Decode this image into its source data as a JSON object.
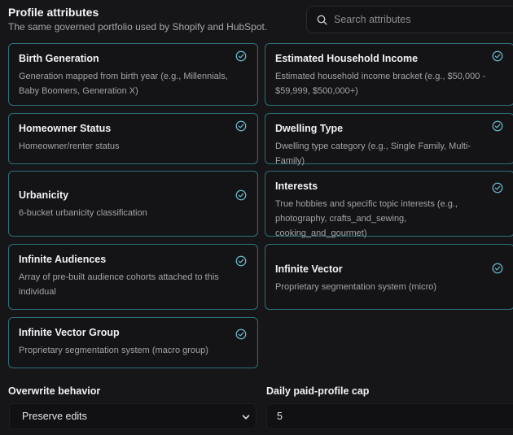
{
  "header": {
    "title": "Profile attributes",
    "subtitle": "The same governed portfolio used by Shopify and HubSpot."
  },
  "search": {
    "placeholder": "Search attributes",
    "icon": "search-icon"
  },
  "accent_color": "#2f6f7c",
  "check_color": "#67b9cc",
  "attributes": [
    {
      "title": "Birth Generation",
      "description": "Generation mapped from birth year (e.g., Millennials, Baby Boomers, Generation X)",
      "selected": true
    },
    {
      "title": "Estimated Household Income",
      "description": "Estimated household income bracket (e.g., $50,000 - $59,999, $500,000+)",
      "selected": true
    },
    {
      "title": "Homeowner Status",
      "description": "Homeowner/renter status",
      "selected": true
    },
    {
      "title": "Dwelling Type",
      "description": "Dwelling type category (e.g., Single Family, Multi-Family)",
      "selected": true
    },
    {
      "title": "Urbanicity",
      "description": "6-bucket urbanicity classification",
      "selected": true
    },
    {
      "title": "Interests",
      "description": "True hobbies and specific topic interests (e.g., photography, crafts_and_sewing, cooking_and_gourmet)",
      "selected": true
    },
    {
      "title": "Infinite Audiences",
      "description": "Array of pre-built audience cohorts attached to this individual",
      "selected": true
    },
    {
      "title": "Infinite Vector",
      "description": "Proprietary segmentation system (micro)",
      "selected": true
    },
    {
      "title": "Infinite Vector Group",
      "description": "Proprietary segmentation system (macro group)",
      "selected": true
    }
  ],
  "overwrite": {
    "label": "Overwrite behavior",
    "value": "Preserve edits"
  },
  "daily_cap": {
    "label": "Daily paid-profile cap",
    "value": "5"
  }
}
